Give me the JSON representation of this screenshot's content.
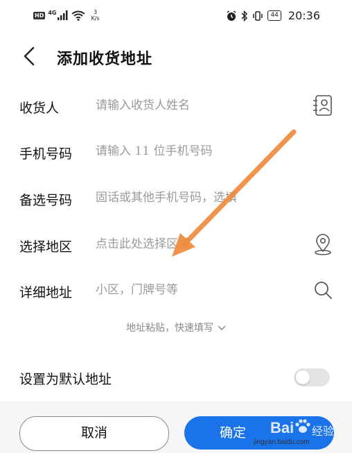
{
  "status_bar": {
    "hd": "HD",
    "network": "4G",
    "speed_value": "3",
    "speed_unit": "K/s",
    "battery": "44",
    "time": "20:36"
  },
  "header": {
    "title": "添加收货地址",
    "back_icon": "chevron-left-icon"
  },
  "form": {
    "receiver": {
      "label": "收货人",
      "placeholder": "请输入收货人姓名",
      "value": "",
      "icon": "contact-book-icon"
    },
    "phone": {
      "label": "手机号码",
      "placeholder": "请输入 11 位手机号码",
      "value": ""
    },
    "alt_phone": {
      "label": "备选号码",
      "placeholder": "固话或其他手机号码，选填",
      "value": ""
    },
    "region": {
      "label": "选择地区",
      "placeholder": "点击此处选择区域",
      "value": "",
      "icon": "location-pin-icon"
    },
    "address": {
      "label": "详细地址",
      "placeholder": "小区，门牌号等",
      "value": "",
      "icon": "search-icon"
    }
  },
  "paste_link": "地址粘贴，快速填写",
  "default_address": {
    "label": "设置为默认地址",
    "enabled": false
  },
  "buttons": {
    "cancel": "取消",
    "confirm": "确定"
  },
  "watermark": {
    "brand": "Bai",
    "brand_suffix": "经验",
    "url": "jingyan.baidu.com"
  },
  "colors": {
    "accent": "#1a73e8",
    "annotation_arrow": "#f08a3c",
    "toggle_off": "#e4e4e4"
  }
}
